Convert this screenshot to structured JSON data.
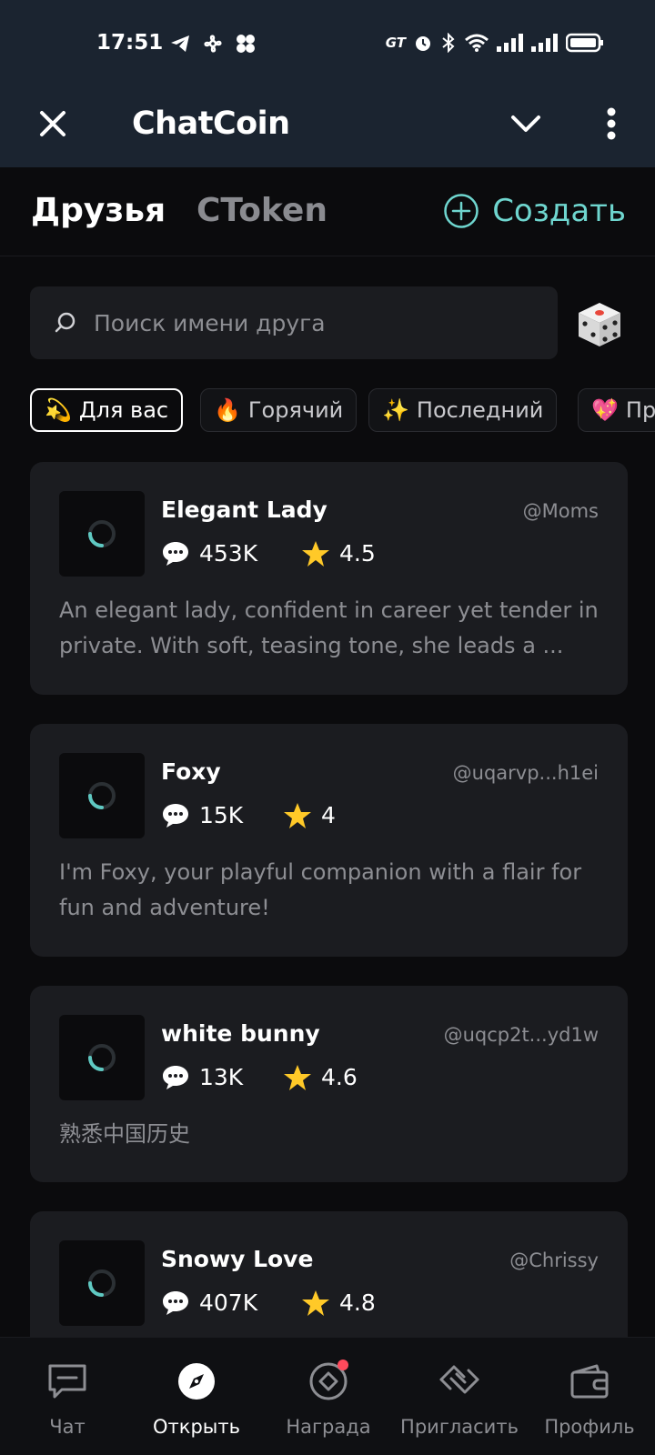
{
  "status_bar": {
    "time": "17:51",
    "carrier_badge": "GT"
  },
  "header": {
    "title": "ChatCoin"
  },
  "tabs": [
    {
      "label": "Друзья",
      "active": true
    },
    {
      "label": "CToken",
      "active": false
    }
  ],
  "create_label": "Создать",
  "search": {
    "placeholder": "Поиск имени друга"
  },
  "filters": [
    {
      "emoji": "💫",
      "label": "Для вас",
      "active": true
    },
    {
      "emoji": "🔥",
      "label": "Горячий",
      "active": false
    },
    {
      "emoji": "✨",
      "label": "Последний",
      "active": false
    },
    {
      "emoji": "💖",
      "label": "Пр",
      "active": false
    }
  ],
  "cards": [
    {
      "name": "Elegant Lady",
      "handle": "@Moms",
      "chats": "453K",
      "rating": "4.5",
      "desc": "An elegant lady, confident in career yet tender in private. With soft, teasing tone, she leads a ..."
    },
    {
      "name": "Foxy",
      "handle": "@uqarvp...h1ei",
      "chats": "15K",
      "rating": "4",
      "desc": "I'm Foxy, your playful companion with a flair for fun and adventure!"
    },
    {
      "name": "white bunny",
      "handle": "@uqcp2t...yd1w",
      "chats": "13K",
      "rating": "4.6",
      "desc": "熟悉中国历史"
    },
    {
      "name": "Snowy Love",
      "handle": "@Chrissy",
      "chats": "407K",
      "rating": "4.8",
      "desc": ""
    }
  ],
  "bottom_nav": [
    {
      "label": "Чат",
      "icon": "chat-icon",
      "active": false
    },
    {
      "label": "Открыть",
      "icon": "compass-icon",
      "active": true
    },
    {
      "label": "Награда",
      "icon": "reward-icon",
      "active": false,
      "badge": true
    },
    {
      "label": "Пригласить",
      "icon": "invite-icon",
      "active": false
    },
    {
      "label": "Профиль",
      "icon": "wallet-icon",
      "active": false
    }
  ],
  "colors": {
    "accent": "#6fd6cf",
    "background": "#0b0b0d",
    "card": "#1b1c20",
    "header": "#1b2430",
    "badge": "#ff4a5c"
  }
}
